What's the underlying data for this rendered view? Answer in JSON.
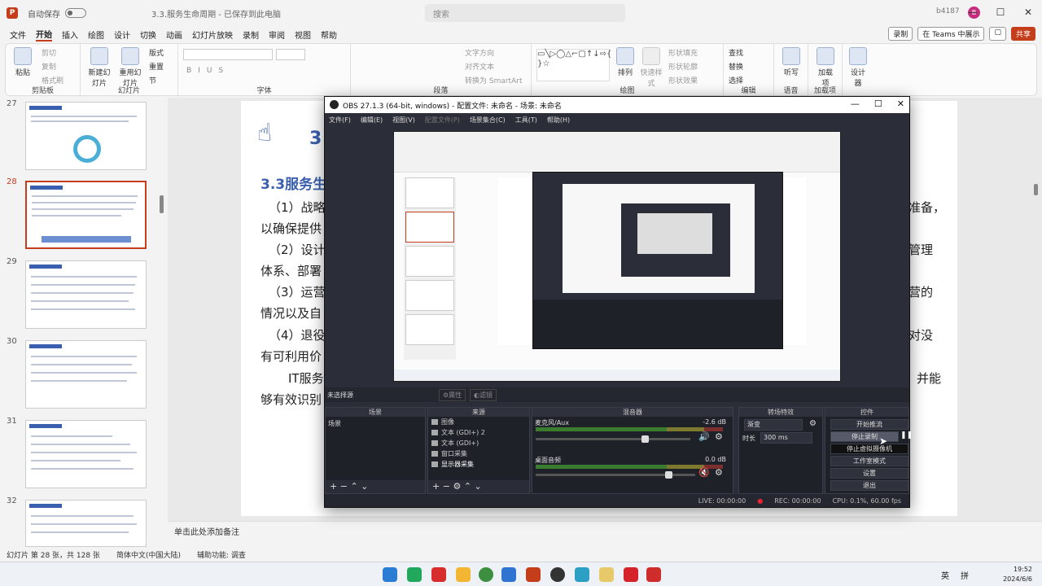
{
  "titlebar": {
    "autosave": "自动保存",
    "toggle_state": "关",
    "doc_name": "3.3.服务生命周期 - 已保存到此电脑",
    "search_placeholder": "搜索",
    "user": "b4187",
    "avatar_initial": "B",
    "minimize": "—",
    "maximize": "☐",
    "close": "✕"
  },
  "menu": {
    "items": [
      "文件",
      "开始",
      "插入",
      "绘图",
      "设计",
      "切换",
      "动画",
      "幻灯片放映",
      "录制",
      "审阅",
      "视图",
      "帮助"
    ],
    "record_btn": "录制",
    "teams_btn": "在 Teams 中展示",
    "share_btn": "共享"
  },
  "ribbon": {
    "paste": "粘贴",
    "cut": "剪切",
    "copy": "复制",
    "format_painter": "格式刷",
    "clipboard": "剪贴板",
    "new_slide": "新建幻灯片",
    "reuse_slide": "重用幻灯片",
    "layout": "版式",
    "reset": "重置",
    "section": "节",
    "slides": "幻灯片",
    "font": "字体",
    "paragraph": "段落",
    "text_direction": "文字方向",
    "align_text": "对齐文本",
    "smartart": "转换为 SmartArt",
    "arrange": "排列",
    "quick_styles": "快速样式",
    "shape_fill": "形状填充",
    "shape_outline": "形状轮廓",
    "shape_effects": "形状效果",
    "drawing": "绘图",
    "find": "查找",
    "replace": "替换",
    "select": "选择",
    "editing": "编辑",
    "dictate": "听写",
    "voice": "语音",
    "addins": "加载项",
    "addins_group": "加载项",
    "designer": "设计器"
  },
  "slides_panel": {
    "numbers": [
      "27",
      "28",
      "29",
      "30",
      "31",
      "32"
    ],
    "selected": "28"
  },
  "slide": {
    "num_label": "3",
    "heading": "3.3服务生命",
    "p1": "（1）战略规",
    "p1_tail": "准备，",
    "p1b": "以确保提供",
    "p2": "（2）设计实",
    "p2_tail": "管理",
    "p2b": "体系、部署",
    "p3": "（3）运营提",
    "p3_tail": "营的",
    "p3b": "情况以及自",
    "p4": "（4）退役终",
    "p4_tail": "对没",
    "p4b": "有可利用价",
    "p5": "IT服务",
    "p5_tail": "并能",
    "p5b": "够有效识别"
  },
  "notes": {
    "placeholder": "单击此处添加备注"
  },
  "statusbar": {
    "slide_info": "幻灯片 第 28 张，共 128 张",
    "language": "简体中文(中国大陆)",
    "accessibility": "辅助功能: 调查"
  },
  "obs": {
    "title": "OBS 27.1.3 (64-bit, windows) - 配置文件: 未命名 - 场景: 未命名",
    "menu": [
      "文件(F)",
      "编辑(E)",
      "视图(V)",
      "配置文件(P)",
      "场景集合(C)",
      "工具(T)",
      "帮助(H)"
    ],
    "no_source": "未选择源",
    "properties": "属性",
    "filters": "滤镜",
    "docks": {
      "scenes": "场景",
      "sources": "来源",
      "mixer": "混音器",
      "transitions": "转场特效",
      "controls": "控件"
    },
    "scene_item": "场景",
    "sources": [
      "图像",
      "文本 (GDI+) 2",
      "文本 (GDI+)",
      "窗口采集",
      "显示器采集"
    ],
    "mixer": [
      {
        "name": "麦克风/Aux",
        "db": "-2.6 dB",
        "level": 0.72
      },
      {
        "name": "桌面音频",
        "db": "0.0 dB",
        "level": 0.85
      }
    ],
    "transition": "渐变",
    "duration_label": "时长",
    "duration": "300 ms",
    "controls": [
      "开始推流",
      "停止录制",
      "停止虚拟摄像机",
      "工作室模式",
      "设置",
      "退出"
    ],
    "status": {
      "live": "LIVE: 00:00:00",
      "rec": "REC: 00:00:00",
      "cpu": "CPU: 0.1%, 60.00 fps"
    }
  },
  "taskbar": {
    "lang": "英",
    "ime": "拼",
    "time": "19:52",
    "date": "2024/6/6"
  },
  "colors": {
    "accent": "#c43e1c",
    "slide_blue": "#3a5fae",
    "obs_bg": "#2b2e38"
  }
}
